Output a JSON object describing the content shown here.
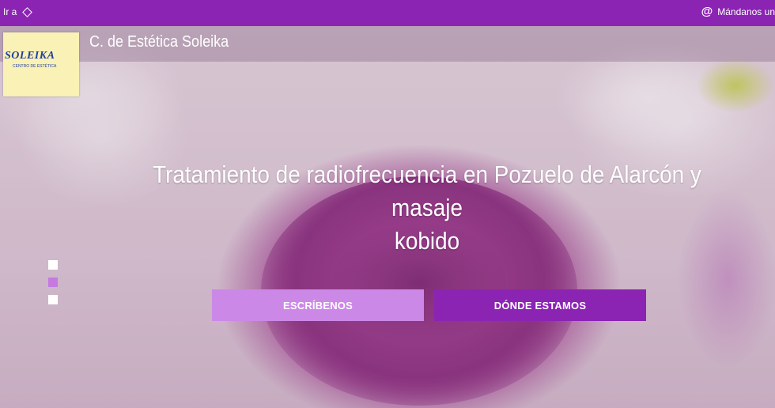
{
  "topbar": {
    "goto_label": "Ir a",
    "mail_label": "Mándanos un ma",
    "mail_icon": "@"
  },
  "brand": {
    "logo_text": "SOLEIKA",
    "logo_subtext": "CENTRO DE ESTÉTICA",
    "title": "C. de Estética Soleika"
  },
  "hero": {
    "headline_line1": "Tratamiento de radiofrecuencia en Pozuelo de Alarcón y masaje",
    "headline_line2": "kobido",
    "slides": 3,
    "active_slide": 2
  },
  "buttons": {
    "write_label": "ESCRÍBENOS",
    "where_label": "DÓNDE ESTAMOS"
  },
  "colors": {
    "brand_purple": "#8b24b3",
    "light_purple": "#cc88e6",
    "logo_bg": "#f9f1b6",
    "logo_text": "#1f3fa0"
  }
}
